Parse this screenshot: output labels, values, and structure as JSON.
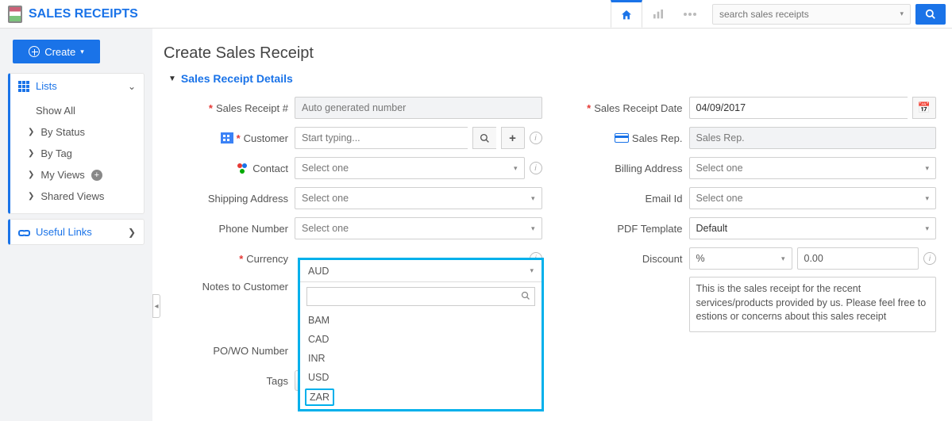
{
  "app_title": "SALES RECEIPTS",
  "top": {
    "search_placeholder": "search sales receipts"
  },
  "sidebar": {
    "create_label": "Create",
    "lists_label": "Lists",
    "show_all": "Show All",
    "by_status": "By Status",
    "by_tag": "By Tag",
    "my_views": "My Views",
    "shared_views": "Shared Views",
    "useful_links": "Useful Links"
  },
  "page": {
    "title": "Create Sales Receipt",
    "section": "Sales Receipt Details"
  },
  "labels": {
    "sales_receipt_no": "Sales Receipt #",
    "customer": "Customer",
    "contact": "Contact",
    "shipping_address": "Shipping Address",
    "phone_number": "Phone Number",
    "currency": "Currency",
    "notes_to_customer": "Notes to Customer",
    "po_wo_number": "PO/WO Number",
    "tags": "Tags",
    "sales_receipt_date": "Sales Receipt Date",
    "sales_rep": "Sales Rep.",
    "billing_address": "Billing Address",
    "email_id": "Email Id",
    "pdf_template": "PDF Template",
    "discount": "Discount"
  },
  "values": {
    "sales_receipt_no_placeholder": "Auto generated number",
    "customer_placeholder": "Start typing...",
    "contact_placeholder": "Select one",
    "shipping_address_placeholder": "Select one",
    "phone_number_placeholder": "Select one",
    "currency_selected": "AUD",
    "sales_receipt_date": "04/09/2017",
    "sales_rep_placeholder": "Sales Rep.",
    "billing_address_placeholder": "Select one",
    "email_id_placeholder": "Select one",
    "pdf_template_value": "Default",
    "discount_unit": "%",
    "discount_value": "0.00",
    "notes_text": "This is the sales receipt for the recent services/products provided by us. Please feel free to estions or concerns about this sales receipt"
  },
  "currency_options": [
    "BAM",
    "CAD",
    "INR",
    "USD",
    "ZAR"
  ]
}
